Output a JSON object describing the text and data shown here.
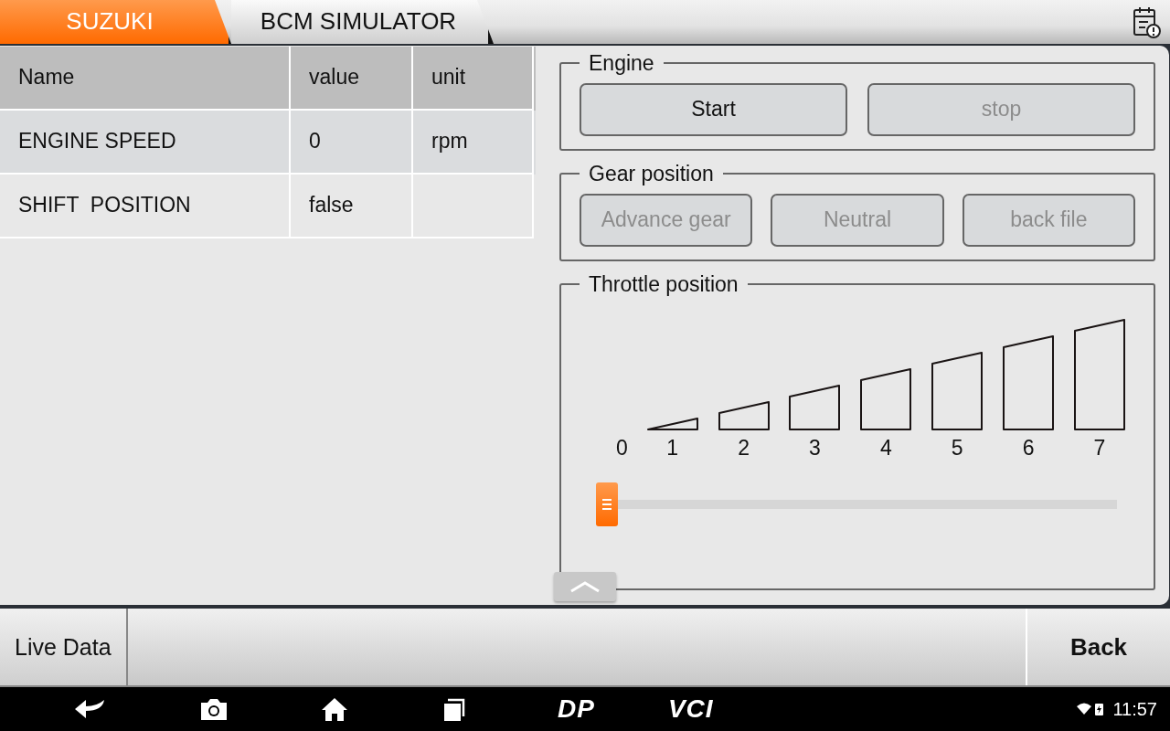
{
  "breadcrumbs": [
    {
      "label": "SUZUKI",
      "selected": true
    },
    {
      "label": "BCM SIMULATOR",
      "selected": false
    }
  ],
  "table": {
    "columns": [
      "Name",
      "value",
      "unit"
    ],
    "rows": [
      {
        "cells": [
          "ENGINE SPEED",
          "0",
          "rpm"
        ],
        "selected": true
      },
      {
        "cells": [
          "SHIFT  POSITION",
          "false",
          ""
        ],
        "selected": false
      }
    ]
  },
  "engine": {
    "title": "Engine",
    "buttons": [
      {
        "label": "Start",
        "disabled": false
      },
      {
        "label": "stop",
        "disabled": true
      }
    ]
  },
  "gear": {
    "title": "Gear position",
    "buttons": [
      {
        "label": "Advance gear",
        "disabled": true
      },
      {
        "label": "Neutral",
        "disabled": true
      },
      {
        "label": "back file",
        "disabled": true
      }
    ]
  },
  "throttle": {
    "title": "Throttle position",
    "steps": [
      "0",
      "1",
      "2",
      "3",
      "4",
      "5",
      "6",
      "7"
    ]
  },
  "bottom_bar": {
    "left": "Live Data",
    "right": "Back"
  },
  "nav_bar": {
    "logos": [
      "DP",
      "VCI"
    ],
    "time": "11:57"
  }
}
